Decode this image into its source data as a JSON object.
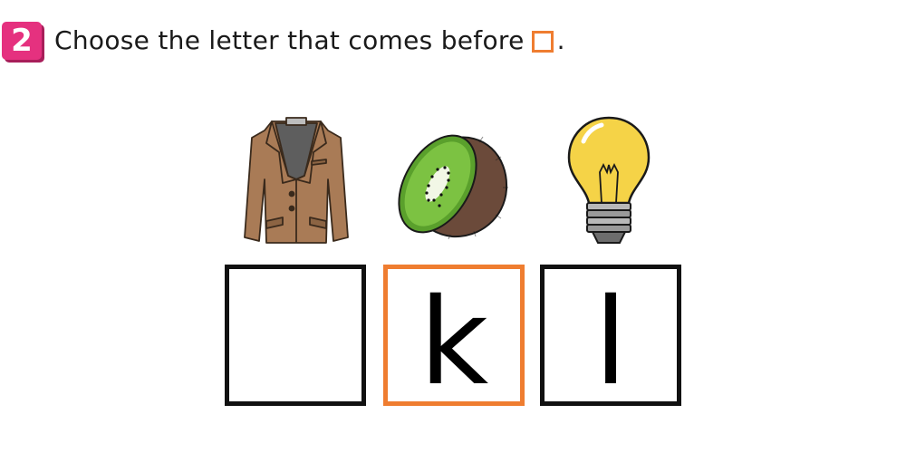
{
  "question": {
    "number": "2",
    "prompt_text": "Choose the letter that comes before",
    "prompt_end": "."
  },
  "pictures": [
    {
      "icon": "jacket-icon"
    },
    {
      "icon": "kiwi-icon"
    },
    {
      "icon": "light-bulb-icon"
    }
  ],
  "letter_boxes": [
    {
      "letter": "",
      "highlight": false
    },
    {
      "letter": "k",
      "highlight": true
    },
    {
      "letter": "l",
      "highlight": false
    }
  ],
  "colors": {
    "badge": "#e5317f",
    "highlight": "#ef7d30",
    "box_border": "#111111"
  }
}
